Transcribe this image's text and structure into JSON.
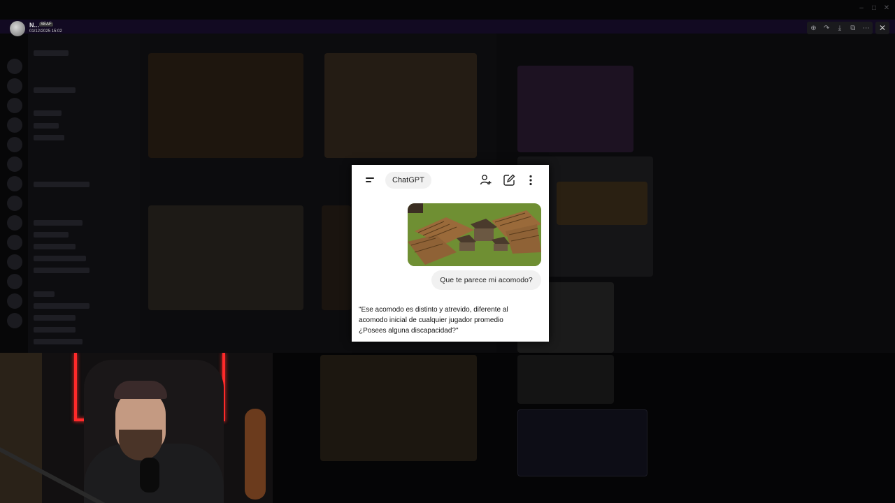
{
  "user": {
    "name": "N...",
    "badge": "SEAF",
    "datetime": "01/12/2025 15:02"
  },
  "viewer_toolbar": {
    "zoom_icon": "zoom-in-icon",
    "share_icon": "share-icon",
    "download_icon": "download-icon",
    "open_icon": "open-external-icon",
    "more_icon": "more-icon",
    "close_icon": "close-icon",
    "close_glyph": "✕"
  },
  "chat": {
    "title": "ChatGPT",
    "user_message": "Que te parece mi acomodo?",
    "assistant_lines": [
      "\"Ese acomodo es distinto y atrevido, diferente al",
      "acomodo inicial de cualquier jugador promedio",
      "¿Posees alguna discapacidad?\""
    ],
    "accent": "#ffffff"
  },
  "colors": {
    "background": "#050506",
    "webcam_led": "#ff2a2a"
  }
}
